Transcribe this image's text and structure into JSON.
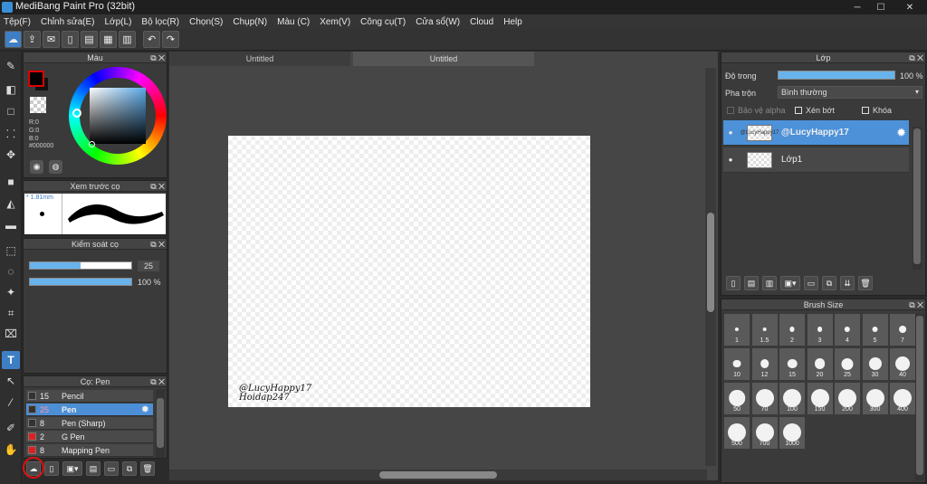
{
  "window": {
    "title": "MediBang Paint Pro (32bit)",
    "min": "─",
    "max": "☐",
    "close": "✕"
  },
  "menu": [
    "Tệp(F)",
    "Chỉnh sửa(E)",
    "Lớp(L)",
    "Bộ lọc(R)",
    "Chọn(S)",
    "Chụp(N)",
    "Màu (C)",
    "Xem(V)",
    "Công cụ(T)",
    "Cửa sổ(W)",
    "Cloud",
    "Help"
  ],
  "color_panel": {
    "title": "Màu",
    "r": "R:0",
    "g": "G:0",
    "b": "B:0",
    "hex": "#000000",
    "accent": "#5aa8e6"
  },
  "brush_preview": {
    "title": "Xem trước cọ",
    "size": "* 1.81mm"
  },
  "brush_control": {
    "title": "Kiểm soát cọ",
    "size_value": "25",
    "size_fraction": 0.5,
    "opacity_value": "100 %",
    "opacity_fraction": 1.0
  },
  "brush_list": {
    "title": "Cọ: Pen",
    "items": [
      {
        "size": "15",
        "name": "Pencil",
        "color": "#333333"
      },
      {
        "size": "25",
        "name": "Pen",
        "color": "#333333",
        "selected": true
      },
      {
        "size": "8",
        "name": "Pen (Sharp)",
        "color": "#333333"
      },
      {
        "size": "2",
        "name": "G Pen",
        "color": "#e02020"
      },
      {
        "size": "8",
        "name": "Mapping Pen",
        "color": "#e02020"
      }
    ]
  },
  "tabs": [
    "Untitled",
    "Untitled"
  ],
  "canvas": {
    "signature_line1": "@LucyHappy17",
    "signature_line2": "Hoidap247"
  },
  "layer_panel": {
    "title": "Lớp",
    "opacity_label": "Độ trong",
    "opacity_value": "100 %",
    "opacity_fraction": 1.0,
    "blend_label": "Pha trộn",
    "blend_value": "Bình thường",
    "protect_alpha": "Bảo vệ alpha",
    "clipping": "Xén bớt",
    "lock": "Khóa",
    "layers": [
      {
        "name": "@LucyHappy17",
        "thumb": "@LucyHappy17",
        "selected": true
      },
      {
        "name": "Lớp1",
        "thumb": "",
        "selected": false
      }
    ]
  },
  "brush_size_panel": {
    "title": "Brush Size",
    "sizes": [
      "1",
      "1.5",
      "2",
      "3",
      "4",
      "5",
      "7",
      "10",
      "12",
      "15",
      "20",
      "25",
      "30",
      "40",
      "50",
      "70",
      "100",
      "150",
      "200",
      "300",
      "400",
      "500",
      "700",
      "1000"
    ]
  }
}
